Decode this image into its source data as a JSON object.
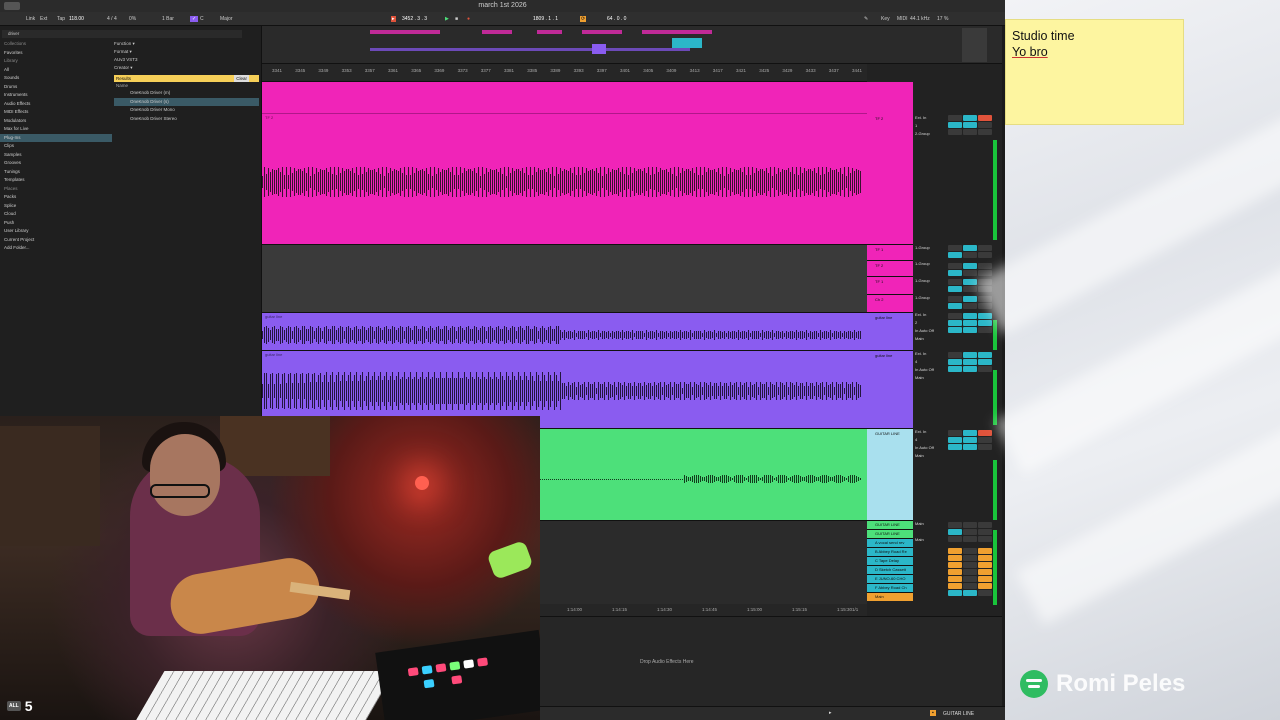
{
  "window": {
    "title": "march 1st 2026"
  },
  "control_bar": {
    "link": "Link",
    "ext": "Ext",
    "tap": "Tap",
    "tempo": "118.00",
    "signature": "4 / 4",
    "swing": "0%",
    "quantize": "1 Bar",
    "key": "C",
    "scale": "Major",
    "position": "3452 .  3 .  3",
    "loop_start": "1809 .  1 .  1",
    "loop_length": "64 .  0 .  0",
    "key_map": "Key",
    "midi_map": "MIDI",
    "sample_rate": "44.1 kHz",
    "cpu": "17 %"
  },
  "browser": {
    "search_value": "driver",
    "sidebar": [
      {
        "label": "Collections",
        "header": true
      },
      {
        "label": "Favorites"
      },
      {
        "label": "Library",
        "header": true
      },
      {
        "label": "All"
      },
      {
        "label": "Sounds"
      },
      {
        "label": "Drums"
      },
      {
        "label": "Instruments"
      },
      {
        "label": "Audio Effects"
      },
      {
        "label": "MIDI Effects"
      },
      {
        "label": "Modulators"
      },
      {
        "label": "Max for Live"
      },
      {
        "label": "Plug-Ins",
        "selected": true
      },
      {
        "label": "Clips"
      },
      {
        "label": "Samples"
      },
      {
        "label": "Grooves"
      },
      {
        "label": "Tunings"
      },
      {
        "label": "Templates"
      },
      {
        "label": "Places",
        "header": true
      },
      {
        "label": "Packs"
      },
      {
        "label": "Splice"
      },
      {
        "label": "Cloud"
      },
      {
        "label": "Push"
      },
      {
        "label": "User Library"
      },
      {
        "label": "Current Project"
      },
      {
        "label": "Add Folder..."
      }
    ],
    "filters": [
      "Function ▾",
      "Format ▾",
      "AUv3   VST3",
      "Creator ▾"
    ],
    "results_label": "Results",
    "clear_label": "Clear",
    "name_col": "Name",
    "results": [
      {
        "label": "OneKnob Driver (m)"
      },
      {
        "label": "OneKnob Driver (s)",
        "selected": true
      },
      {
        "label": "OneKnob Driver Mono"
      },
      {
        "label": "OneKnob Driver Stereo"
      }
    ]
  },
  "ruler": {
    "ticks": [
      "3341",
      "3345",
      "3349",
      "3353",
      "3357",
      "3361",
      "3365",
      "3369",
      "3373",
      "3377",
      "3381",
      "3385",
      "3389",
      "3393",
      "3397",
      "3401",
      "3405",
      "3409",
      "3413",
      "3417",
      "3421",
      "3425",
      "3429",
      "3433",
      "3437",
      "3441"
    ]
  },
  "time_ruler": {
    "ticks": [
      "1:14:00",
      "1:14:15",
      "1:14:30",
      "1:14:45",
      "1:15:00",
      "1:15:15",
      "1:15:30"
    ],
    "zoom": "1/1"
  },
  "tracks": [
    {
      "name": "TF 2",
      "color": "#f024b8",
      "input": "Ext. In",
      "ch": "1",
      "routing": "2-Group",
      "vol": "-4.0"
    },
    {
      "name": "TF 1",
      "color": "#f024b8",
      "routing": "1-Group",
      "vol": "-4.7"
    },
    {
      "name": "TF 2",
      "color": "#f024b8",
      "routing": "1-Group",
      "vol": "-4.7"
    },
    {
      "name": "TF 1",
      "color": "#f024b8",
      "routing": "1-Group",
      "vol": "-4.7"
    },
    {
      "name": "Ch 2",
      "color": "#f024b8",
      "routing": "1-Group",
      "vol": "-4.7"
    },
    {
      "name": "guitar line",
      "color": "#8a5cf0",
      "input": "Ext. In",
      "ch": "2",
      "monitor": "In Auto Off",
      "routing": "Main",
      "vol": "-8.7",
      "pan": "21.4"
    },
    {
      "name": "guitar line",
      "color": "#8a5cf0",
      "input": "Ext. In",
      "ch": "4",
      "monitor": "In Auto Off",
      "routing": "Main",
      "vol": "-10.8",
      "pan": "21.4"
    },
    {
      "name": "GUITAR LINE",
      "color": "#4de07a",
      "input": "Ext. In",
      "ch": "4",
      "monitor": "In Auto Off",
      "routing": "Main",
      "vol": "0"
    }
  ],
  "returns": [
    {
      "name": "GUITAR LINE",
      "routing": "Main",
      "vol": "-6.4"
    },
    {
      "name": "GUITAR LINE",
      "routing": "Main"
    },
    {
      "name": "A vocal send rev"
    },
    {
      "name": "B Abbey Road Re"
    },
    {
      "name": "C Tape Delay"
    },
    {
      "name": "D Sketch Cassett"
    },
    {
      "name": "E JUNO-60 CHO"
    },
    {
      "name": "F Abbey Road Ch"
    },
    {
      "name": "Main",
      "vol": "-9.8"
    }
  ],
  "detail": {
    "drop_hint": "Drop Audio Effects Here"
  },
  "status": {
    "selected_track": "GUITAR LINE"
  },
  "sticky_note": {
    "line1": "Studio time",
    "line2": "Yo bro"
  },
  "overlay": {
    "artist": "Romi Peles",
    "badge_all": "ALL",
    "badge_num": "5"
  },
  "colors": {
    "pink": "#f024b8",
    "purple": "#8a5cf0",
    "green": "#4de07a",
    "cyan": "#2bb7c8",
    "accent": "#f6cf58"
  }
}
